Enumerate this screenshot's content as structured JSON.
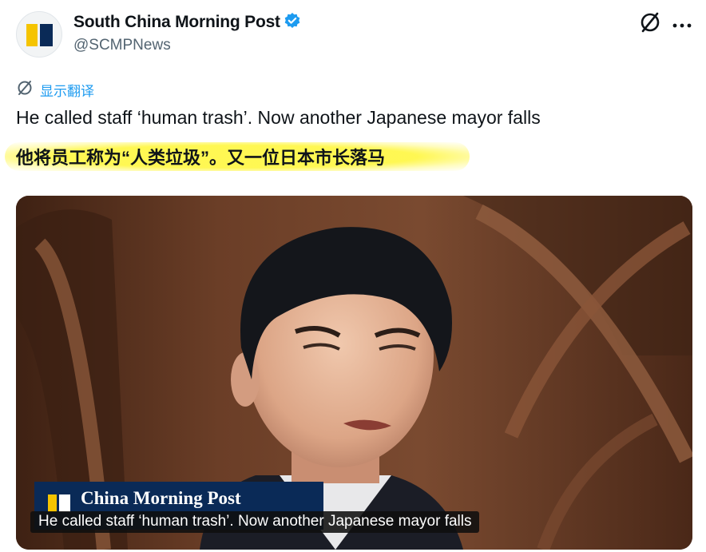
{
  "author": {
    "name": "South China Morning Post",
    "handle": "@SCMPNews",
    "verified": true
  },
  "translate": {
    "label": "显示翻译"
  },
  "tweet": {
    "text": "He called staff ‘human trash’. Now another Japanese mayor falls",
    "chinese_text": "他将员工称为“人类垃圾”。又一位日本市长落马"
  },
  "media": {
    "watermark": "China Morning Post",
    "caption": "He called staff ‘human trash’. Now another Japanese mayor falls"
  },
  "colors": {
    "accent": "#1d9bf0",
    "brand_yellow": "#f5c400",
    "brand_navy": "#0a2a57",
    "highlight": "#fff74a"
  },
  "icons": {
    "top_right": [
      "grok-icon",
      "more-icon"
    ],
    "translate": "translate-icon"
  }
}
